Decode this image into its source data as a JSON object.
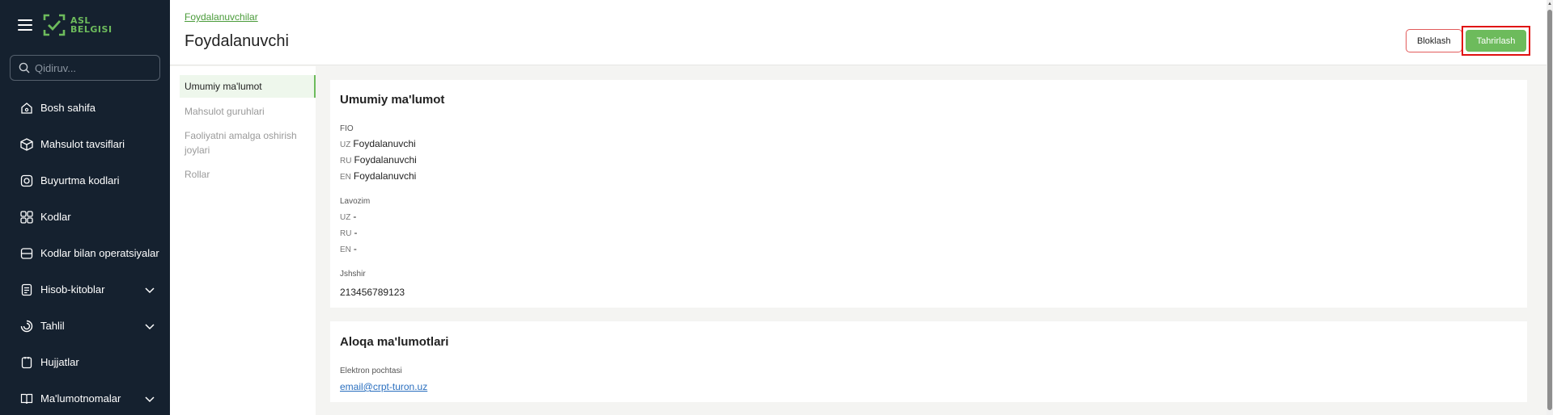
{
  "brand": {
    "logo_line1": "ASL",
    "logo_line2": "BELGISI",
    "accent": "#6dbb5c",
    "sidebar_bg": "#15212f"
  },
  "search": {
    "placeholder": "Qidiruv..."
  },
  "sidebar": {
    "items": [
      {
        "label": "Bosh sahifa",
        "icon": "home-icon"
      },
      {
        "label": "Mahsulot tavsiflari",
        "icon": "box-icon"
      },
      {
        "label": "Buyurtma kodlari",
        "icon": "order-codes-icon"
      },
      {
        "label": "Kodlar",
        "icon": "qr-codes-icon"
      },
      {
        "label": "Kodlar bilan operatsiyalar",
        "icon": "operations-icon"
      },
      {
        "label": "Hisob-kitoblar",
        "icon": "receipt-icon",
        "expandable": true
      },
      {
        "label": "Tahlil",
        "icon": "analytics-icon",
        "expandable": true
      },
      {
        "label": "Hujjatlar",
        "icon": "document-icon"
      },
      {
        "label": "Ma'lumotnomalar",
        "icon": "book-icon",
        "expandable": true
      }
    ]
  },
  "header": {
    "breadcrumb": "Foydalanuvchilar",
    "title": "Foydalanuvchi",
    "block_label": "Bloklash",
    "edit_label": "Tahrirlash"
  },
  "subnav": {
    "items": [
      {
        "label": "Umumiy ma'lumot",
        "active": true
      },
      {
        "label": "Mahsulot guruhlari"
      },
      {
        "label": "Faoliyatni amalga oshirish joylari"
      },
      {
        "label": "Rollar"
      }
    ]
  },
  "general": {
    "title": "Umumiy ma'lumot",
    "fio_label": "FIO",
    "fio": [
      {
        "lang": "UZ",
        "value": "Foydalanuvchi"
      },
      {
        "lang": "RU",
        "value": "Foydalanuvchi"
      },
      {
        "lang": "EN",
        "value": "Foydalanuvchi"
      }
    ],
    "position_label": "Lavozim",
    "position": [
      {
        "lang": "UZ",
        "value": "-"
      },
      {
        "lang": "RU",
        "value": "-"
      },
      {
        "lang": "EN",
        "value": "-"
      }
    ],
    "pinfl_label": "Jshshir",
    "pinfl": "213456789123"
  },
  "contact": {
    "title": "Aloqa ma'lumotlari",
    "email_label": "Elektron pochtasi",
    "email": "email@crpt-turon.uz"
  }
}
